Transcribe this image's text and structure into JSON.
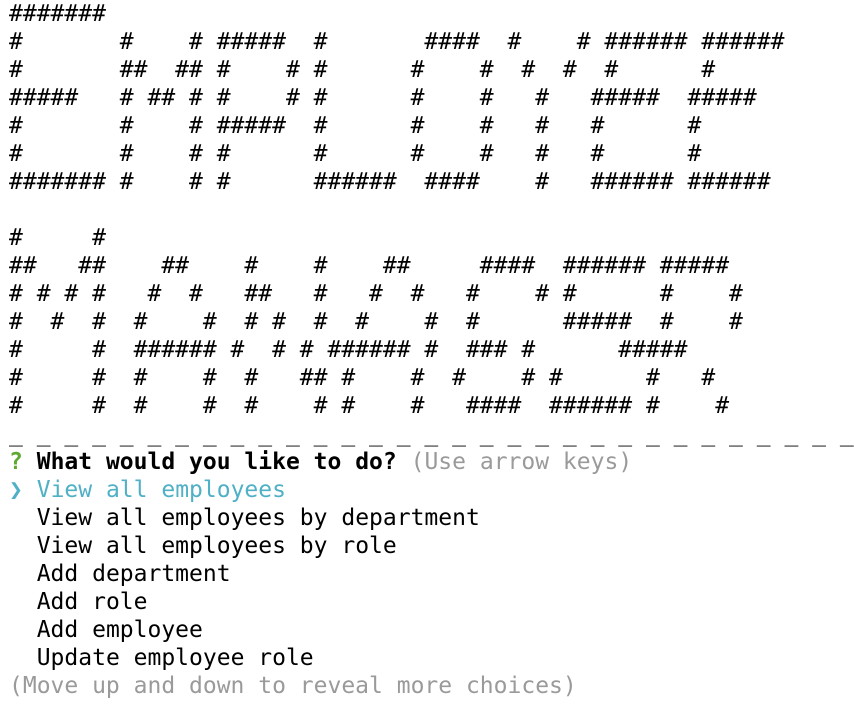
{
  "banner": {
    "employee_lines": [
      "#######",
      "#       #    # #####  #       ####  #    # ###### ######",
      "#       ##  ## #    # #      #    #  #  #  #      #",
      "#####   # ## # #    # #      #    #   #   #####  #####",
      "#       #    # #####  #      #    #   #   #      #",
      "#       #    # #      #      #    #   #   #      #",
      "####### #    # #      ######  ####    #   ###### ######"
    ],
    "manager_lines": [
      "#     #",
      "##   ##    ##    #    #    ##     ####  ###### #####",
      "# # # #   #  #   ##   #   #  #   #    # #      #    #",
      "#  #  #  #    #  # #  #  #    #  #      #####  #    #",
      "#     #  ###### #  # # ###### #  ### #      #####",
      "#     #  #    #  #   ## #    #  #    # #      #   #",
      "#     #  #    #  #    # #    #   ####  ###### #    #"
    ],
    "divider": "_ _ _ _ _ _ _ _ _ _ _ _ _ _ _ _ _ _ _ _ _ _ _ _ _ _ _ _ _ _ _"
  },
  "prompt": {
    "mark": "?",
    "question": "What would you like to do?",
    "hint": "(Use arrow keys)",
    "pointer": "❯",
    "selected": "View all employees",
    "choices": [
      "View all employees by department",
      "View all employees by role",
      "Add department",
      "Add role",
      "Add employee",
      "Update employee role"
    ],
    "more_hint": "(Move up and down to reveal more choices)"
  },
  "colors": {
    "question_mark": "#5fa832",
    "selection": "#4fb0c6",
    "hint": "#9a9a9a"
  }
}
